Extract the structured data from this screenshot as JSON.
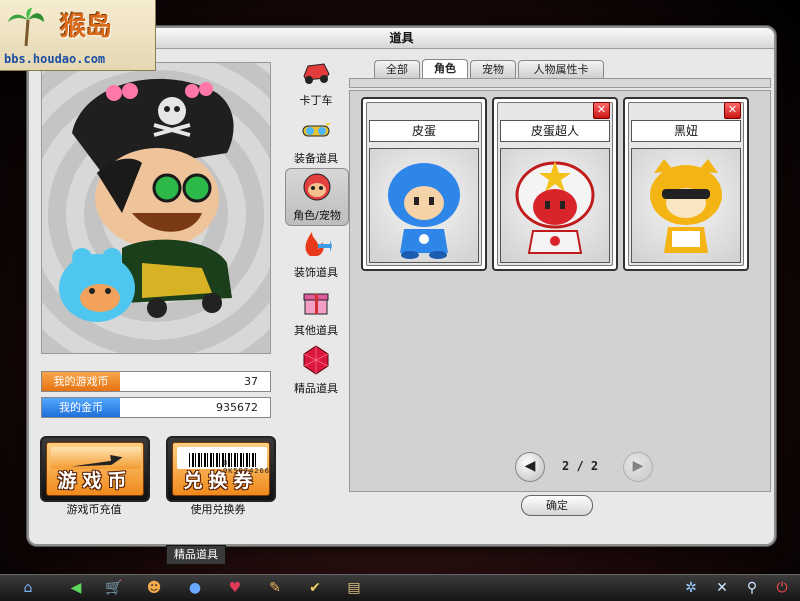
{
  "watermark": {
    "logo": "猴岛",
    "site": "bbs.houdao.com"
  },
  "window": {
    "title": "道具"
  },
  "stats": [
    {
      "label": "我的游戏币",
      "value": "37"
    },
    {
      "label": "我的金币",
      "value": "935672"
    }
  ],
  "actions": [
    {
      "label": "游戏币",
      "caption": "游戏币充值"
    },
    {
      "label": "兑换券",
      "caption": "使用兑换券",
      "code": "B 0K5B74266"
    }
  ],
  "categories": [
    {
      "label": "卡丁车",
      "icon": "kart-icon"
    },
    {
      "label": "装备道具",
      "icon": "goggles-icon"
    },
    {
      "label": "角色/宠物",
      "icon": "character-face-icon",
      "active": true
    },
    {
      "label": "装饰道具",
      "icon": "flame-arrow-icon"
    },
    {
      "label": "其他道具",
      "icon": "giftbox-icon"
    },
    {
      "label": "精品道具",
      "icon": "ruby-gem-icon"
    }
  ],
  "tabs": [
    {
      "label": "全部"
    },
    {
      "label": "角色",
      "active": true
    },
    {
      "label": "宠物"
    },
    {
      "label": "人物属性卡"
    }
  ],
  "items": [
    {
      "name": "皮蛋",
      "removable": false,
      "color": "#2e86e8"
    },
    {
      "name": "皮蛋超人",
      "removable": true,
      "color": "#d8242a"
    },
    {
      "name": "黑妞",
      "removable": true,
      "color": "#f3b414"
    }
  ],
  "pager": {
    "text": "2 / 2"
  },
  "confirm_label": "确定",
  "tooltip": "精品道具",
  "taskbar": [
    {
      "icon": "home-icon"
    },
    {
      "icon": "back-icon"
    },
    {
      "icon": "shop-cart-icon"
    },
    {
      "icon": "character-icon"
    },
    {
      "icon": "ranking-icon"
    },
    {
      "icon": "heart-icon"
    },
    {
      "icon": "tool-icon"
    },
    {
      "icon": "guild-icon"
    },
    {
      "icon": "book-icon"
    },
    {
      "icon": "network-icon"
    },
    {
      "icon": "settings-icon"
    },
    {
      "icon": "search-icon"
    },
    {
      "icon": "power-icon"
    }
  ]
}
